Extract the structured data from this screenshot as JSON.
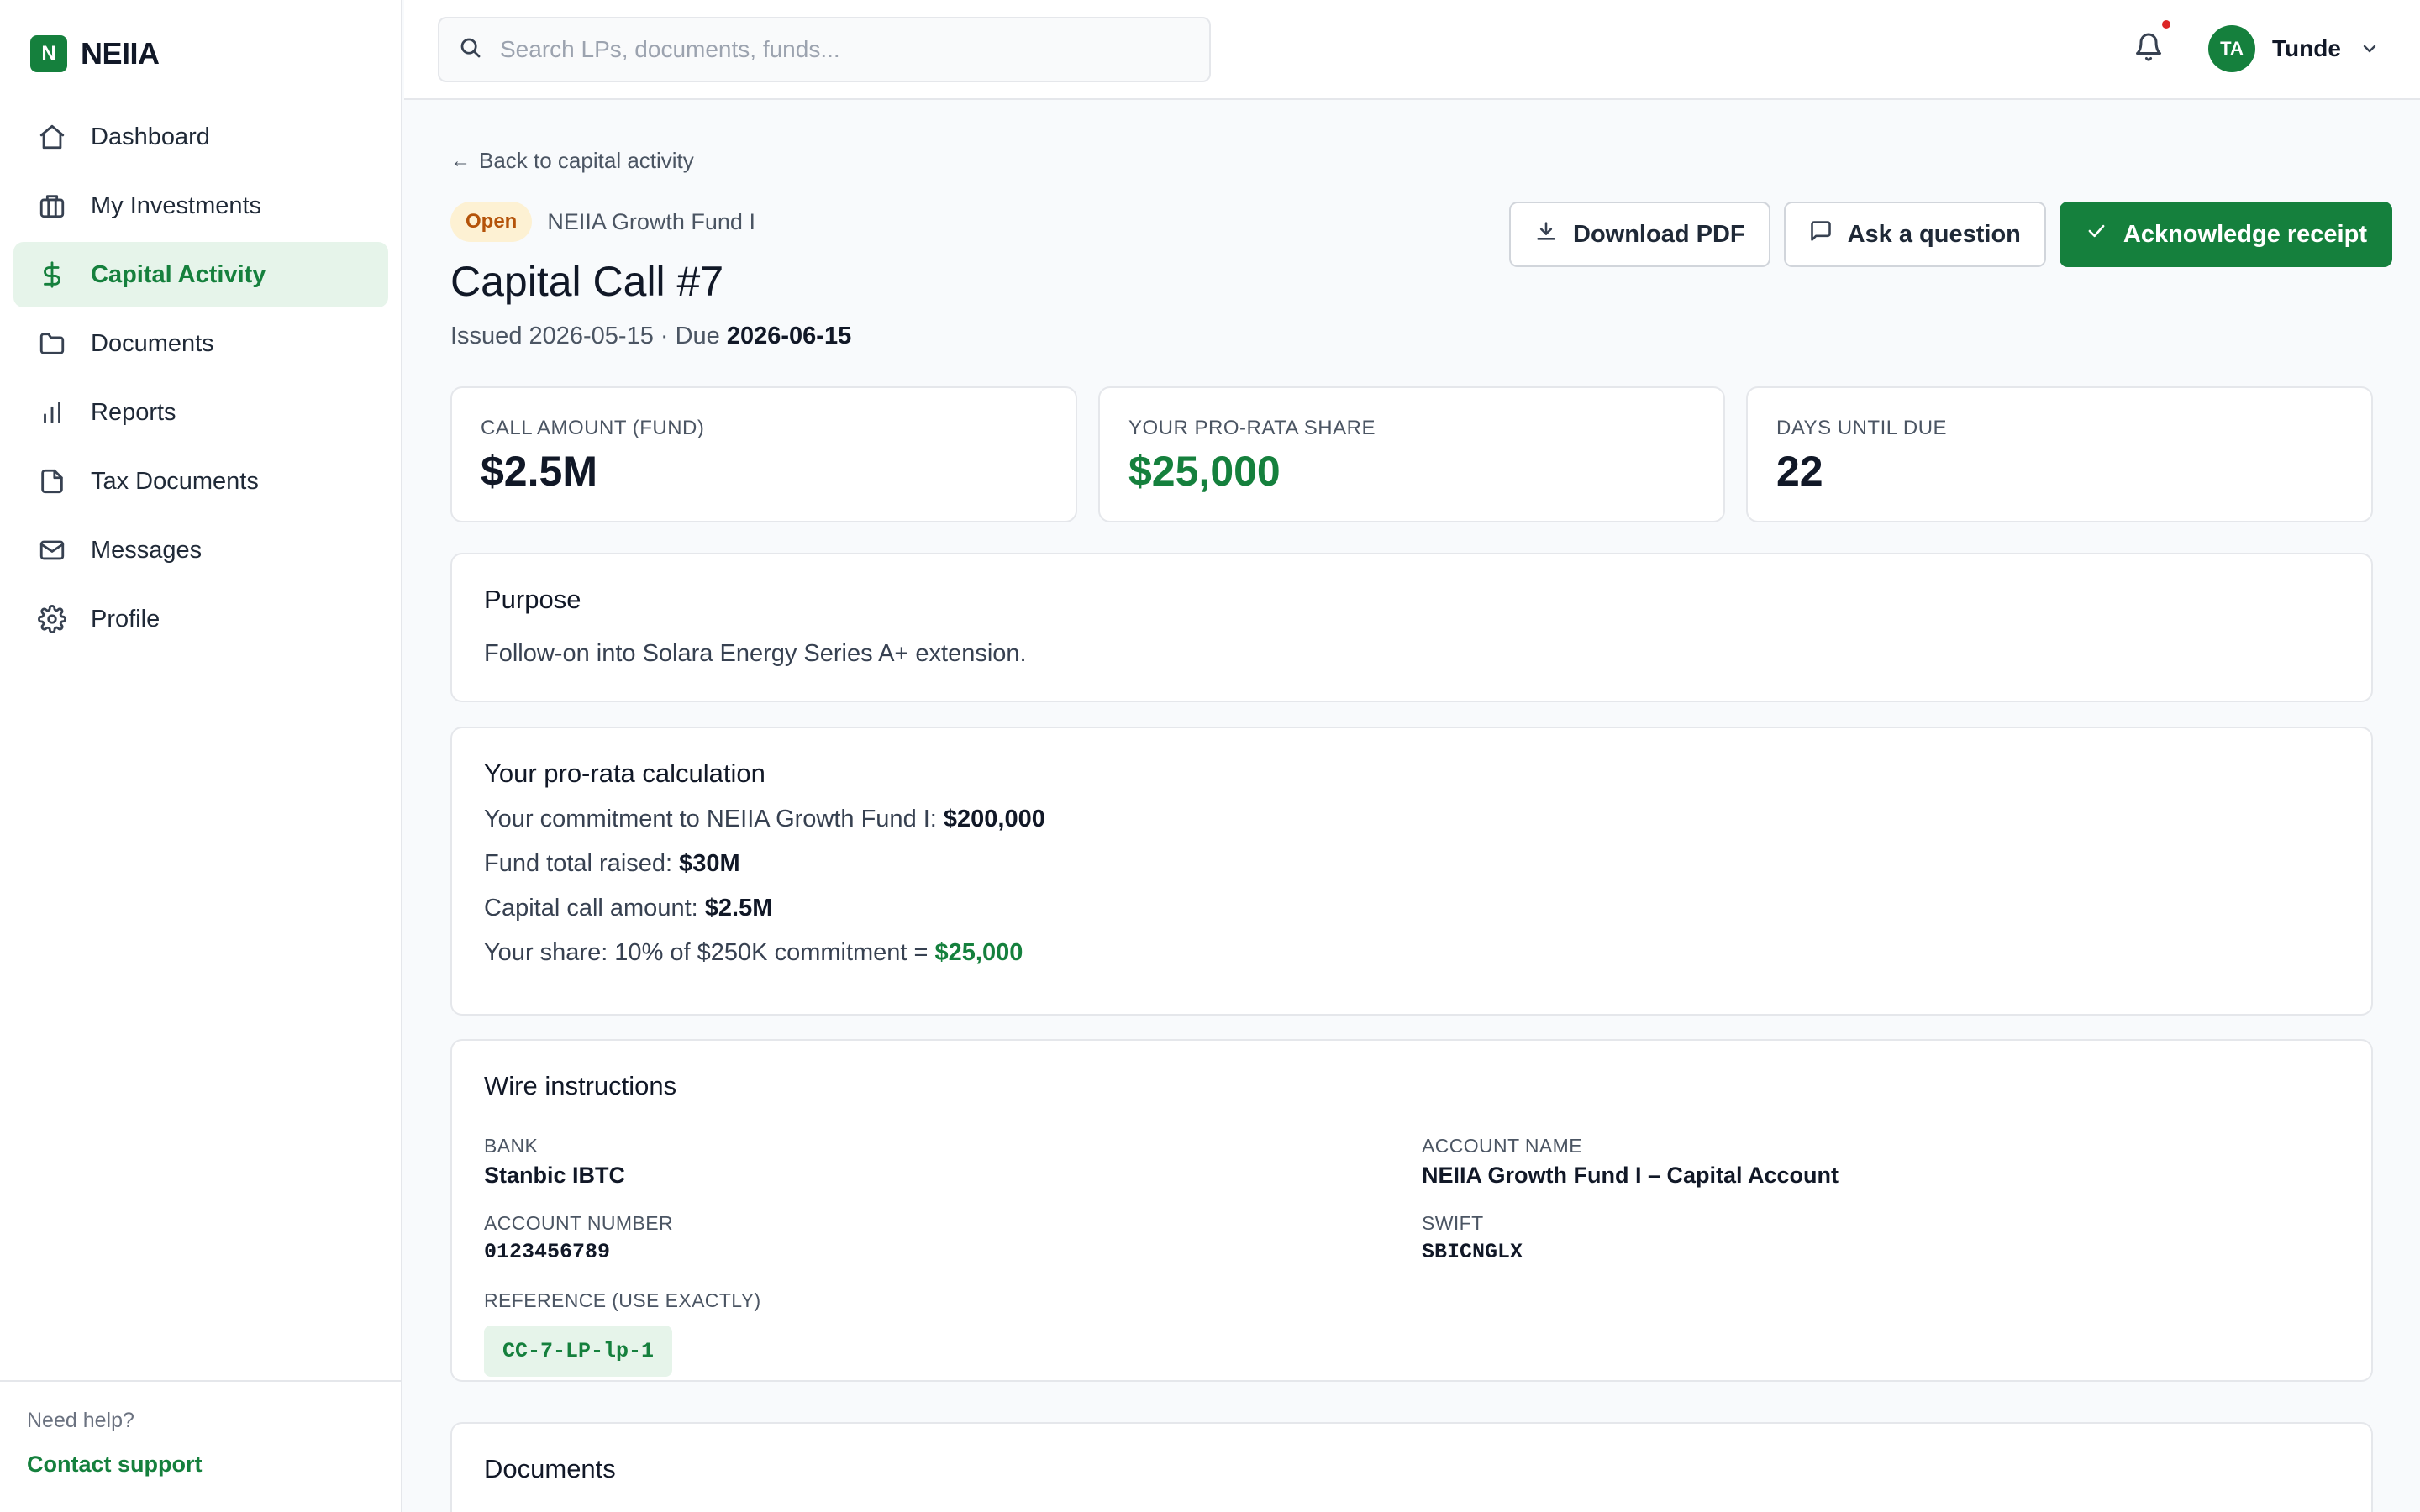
{
  "brand": {
    "logo_letter": "N",
    "name": "NEIIA"
  },
  "sidebar": {
    "items": [
      {
        "label": "Dashboard",
        "icon": "home-icon",
        "active": false
      },
      {
        "label": "My Investments",
        "icon": "briefcase-icon",
        "active": false
      },
      {
        "label": "Capital Activity",
        "icon": "dollar-icon",
        "active": true
      },
      {
        "label": "Documents",
        "icon": "folder-icon",
        "active": false
      },
      {
        "label": "Reports",
        "icon": "bar-chart-icon",
        "active": false
      },
      {
        "label": "Tax Documents",
        "icon": "file-icon",
        "active": false
      },
      {
        "label": "Messages",
        "icon": "mail-icon",
        "active": false
      },
      {
        "label": "Profile",
        "icon": "gear-icon",
        "active": false
      }
    ],
    "help_text": "Need help?",
    "support_link": "Contact support"
  },
  "header": {
    "search_placeholder": "Search LPs, documents, funds...",
    "search_value": "",
    "user": {
      "initials": "TA",
      "name": "Tunde"
    },
    "has_notification": true
  },
  "page": {
    "back_link": "Back to capital activity",
    "status_badge": "Open",
    "fund_name": "NEIIA Growth Fund I",
    "title": "Capital Call #7",
    "issued_text": "Issued 2026-05-15 · Due ",
    "due_date": "2026-06-15",
    "actions": {
      "download": "Download PDF",
      "ask": "Ask a question",
      "acknowledge": "Acknowledge receipt"
    }
  },
  "stats": [
    {
      "label": "CALL AMOUNT (FUND)",
      "value": "$2.5M",
      "highlight": false
    },
    {
      "label": "YOUR PRO-RATA SHARE",
      "value": "$25,000",
      "highlight": true
    },
    {
      "label": "DAYS UNTIL DUE",
      "value": "22",
      "highlight": false
    }
  ],
  "purpose": {
    "title": "Purpose",
    "text": "Follow-on into Solara Energy Series A+ extension."
  },
  "calculation": {
    "title": "Your pro-rata calculation",
    "lines": [
      {
        "label": "Your commitment to NEIIA Growth Fund I: ",
        "value": "$200,000"
      },
      {
        "label": "Fund total raised: ",
        "value": "$30M"
      },
      {
        "label": "Capital call amount: ",
        "value": "$2.5M"
      },
      {
        "label": "Your share: 10% of $250K commitment = ",
        "value": "$25,000"
      }
    ]
  },
  "wire": {
    "title": "Wire instructions",
    "bank_label": "BANK",
    "bank": "Stanbic IBTC",
    "account_name_label": "ACCOUNT NAME",
    "account_name": "NEIIA Growth Fund I – Capital Account",
    "account_number_label": "ACCOUNT NUMBER",
    "account_number": "0123456789",
    "swift_label": "SWIFT",
    "swift": "SBICNGLX",
    "reference_label": "REFERENCE (USE EXACTLY)",
    "reference": "CC-7-LP-lp-1"
  },
  "documents": {
    "title": "Documents"
  },
  "colors": {
    "brand_green": "#15803d",
    "active_bg": "#e6f4ea",
    "badge_bg": "#fdf1d3",
    "badge_text": "#b45309",
    "notification_dot": "#dc2626"
  }
}
